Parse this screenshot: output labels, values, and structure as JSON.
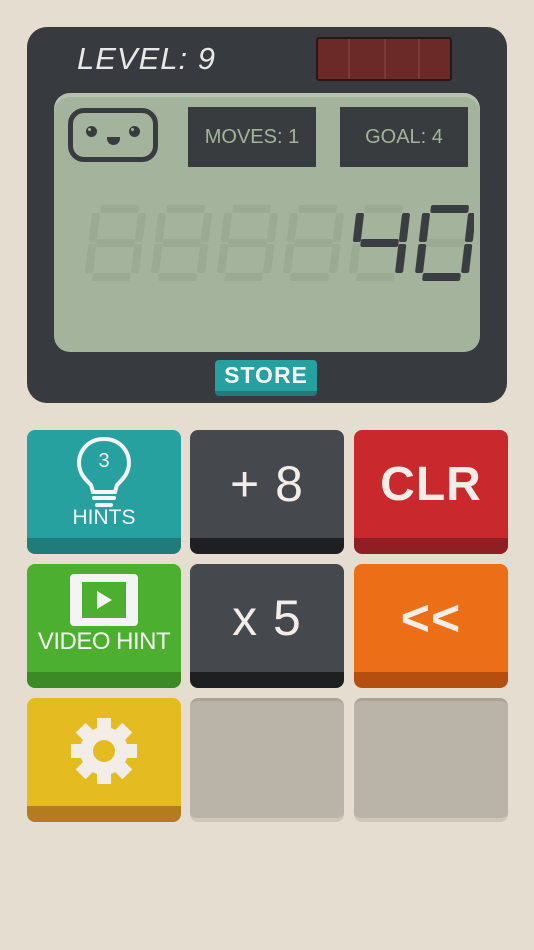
{
  "header": {
    "level_label": "LEVEL: 9"
  },
  "screen": {
    "moves_label": "MOVES: 1",
    "goal_label": "GOAL: 4",
    "display_value": "40",
    "display_digits": 6
  },
  "store_label": "STORE",
  "buttons": {
    "hints": {
      "count": "3",
      "label": "HINTS",
      "icon": "lightbulb-icon"
    },
    "add": {
      "label": "+ 8"
    },
    "clear": {
      "label": "CLR"
    },
    "video": {
      "label": "VIDEO HINT",
      "icon": "play-icon"
    },
    "multiply": {
      "label": "x 5"
    },
    "backspace": {
      "label": "<<"
    },
    "settings": {
      "icon": "gear-icon"
    }
  },
  "colors": {
    "background": "#e5ddd0",
    "device": "#373b40",
    "lcd": "#a3b39c",
    "teal": "#26a19f",
    "red": "#c9292d",
    "green": "#4caf30",
    "orange": "#ec6f18",
    "yellow": "#e4bc22"
  }
}
